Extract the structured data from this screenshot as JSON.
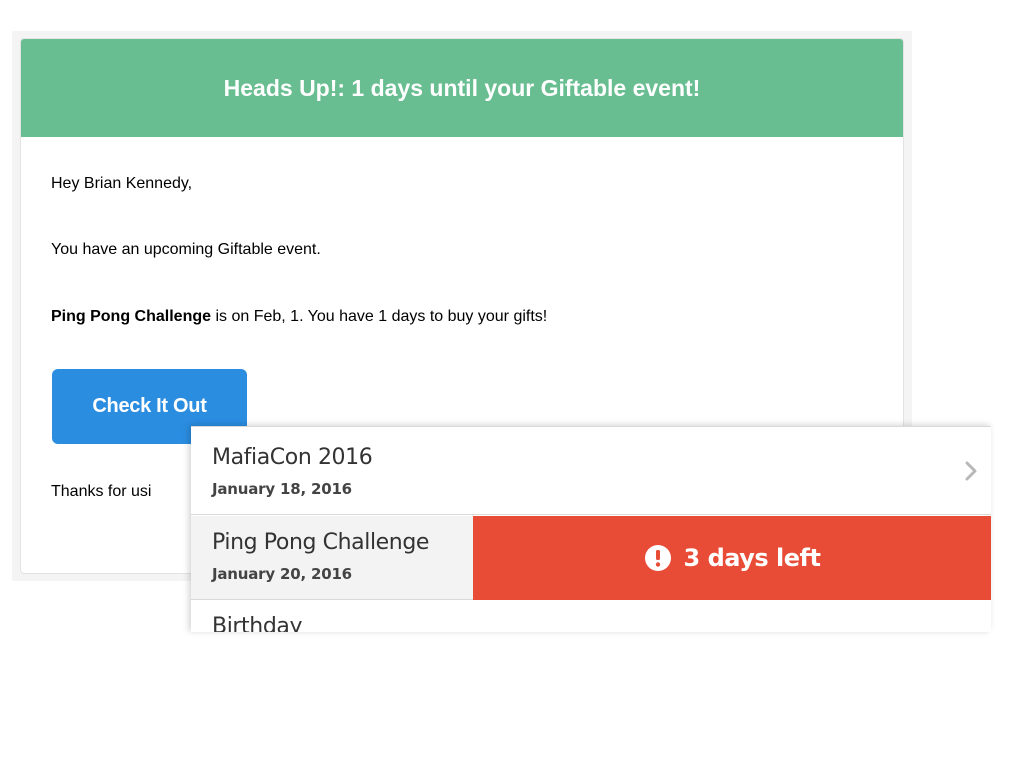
{
  "email": {
    "header_title": "Heads Up!: 1 days until your Giftable event!",
    "greeting": "Hey Brian Kennedy,",
    "intro": "You have an upcoming Giftable event.",
    "event_name": "Ping Pong Challenge",
    "event_detail": " is on Feb, 1. You have 1 days to buy your gifts!",
    "cta_label": "Check It Out",
    "closing": "Thanks for usi"
  },
  "events": [
    {
      "name": "MafiaCon 2016",
      "date": "January 18, 2016"
    },
    {
      "name": "Ping Pong Challenge",
      "date": "January 20, 2016",
      "badge": "3 days left"
    },
    {
      "name": "Birthday"
    }
  ],
  "colors": {
    "header": "#69be91",
    "cta": "#2b8de0",
    "alert": "#e84b36"
  }
}
